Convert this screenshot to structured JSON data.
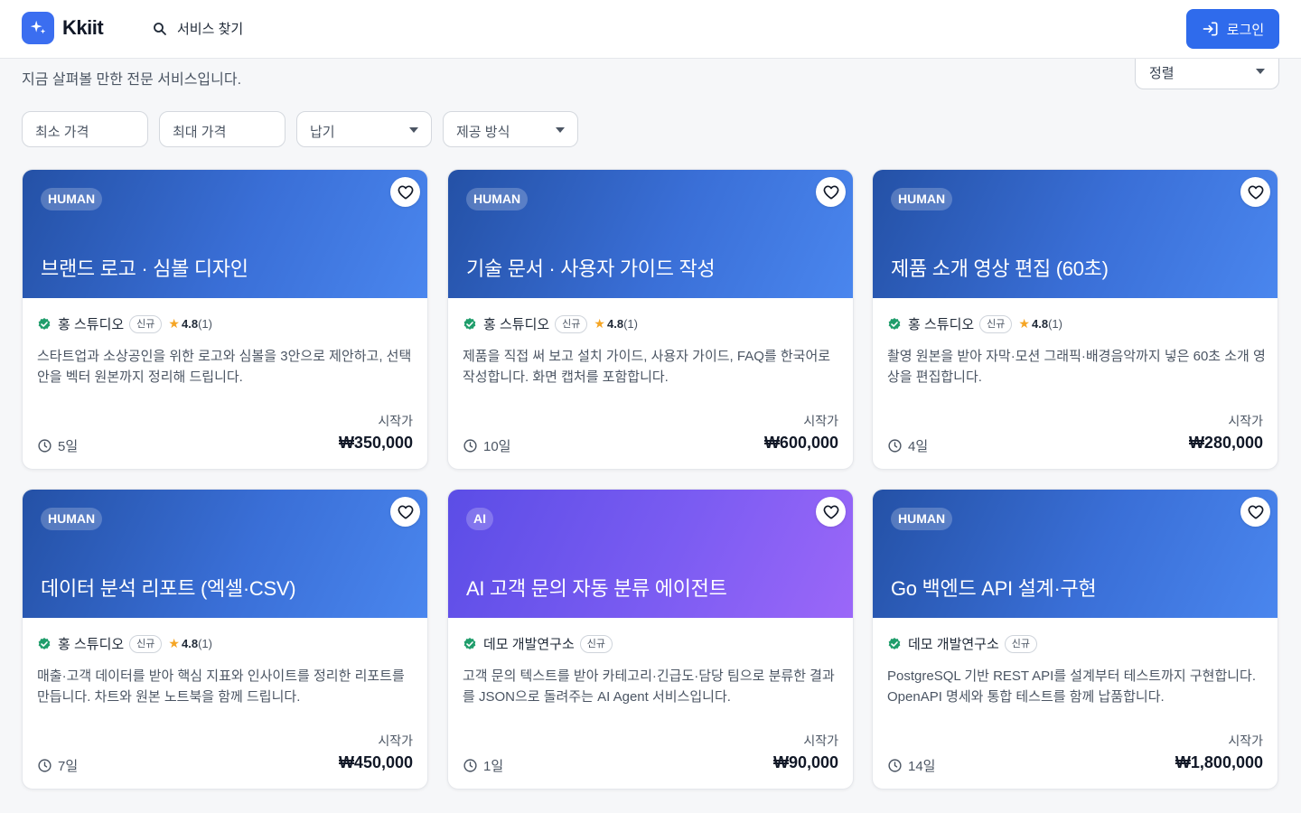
{
  "header": {
    "brand": "Kkiit",
    "search_label": "서비스 찾기",
    "login_label": "로그인"
  },
  "subtitle": "지금 살펴볼 만한 전문 서비스입니다.",
  "sort": {
    "label": "정렬"
  },
  "filters": {
    "min_price": "최소 가격",
    "max_price": "최대 가격",
    "delivery": "납기",
    "provider": "제공 방식"
  },
  "colors": {
    "accent": "#2f6bec",
    "human_banner": "#3a6fd7",
    "ai_banner": "#7b5cf2",
    "star": "#f5a524",
    "verified": "#1f9d6b"
  },
  "cards": [
    {
      "type": "HUMAN",
      "title": "브랜드 로고 · 심볼 디자인",
      "seller": "홍 스튜디오",
      "tag": "신규",
      "rating": "4.8",
      "rating_count": "(1)",
      "description": "스타트업과 소상공인을 위한 로고와 심볼을 3안으로 제안하고, 선택안을 벡터 원본까지 정리해 드립니다.",
      "price_label": "시작가",
      "duration": "5일",
      "price": "₩350,000"
    },
    {
      "type": "HUMAN",
      "title": "기술 문서 · 사용자 가이드 작성",
      "seller": "홍 스튜디오",
      "tag": "신규",
      "rating": "4.8",
      "rating_count": "(1)",
      "description": "제품을 직접 써 보고 설치 가이드, 사용자 가이드, FAQ를 한국어로 작성합니다. 화면 캡처를 포함합니다.",
      "price_label": "시작가",
      "duration": "10일",
      "price": "₩600,000"
    },
    {
      "type": "HUMAN",
      "title": "제품 소개 영상 편집 (60초)",
      "seller": "홍 스튜디오",
      "tag": "신규",
      "rating": "4.8",
      "rating_count": "(1)",
      "description": "촬영 원본을 받아 자막·모션 그래픽·배경음악까지 넣은 60초 소개 영상을 편집합니다.",
      "price_label": "시작가",
      "duration": "4일",
      "price": "₩280,000"
    },
    {
      "type": "HUMAN",
      "title": "데이터 분석 리포트 (엑셀·CSV)",
      "seller": "홍 스튜디오",
      "tag": "신규",
      "rating": "4.8",
      "rating_count": "(1)",
      "description": "매출·고객 데이터를 받아 핵심 지표와 인사이트를 정리한 리포트를 만듭니다. 차트와 원본 노트북을 함께 드립니다.",
      "price_label": "시작가",
      "duration": "7일",
      "price": "₩450,000"
    },
    {
      "type": "AI",
      "title": "AI 고객 문의 자동 분류 에이전트",
      "seller": "데모 개발연구소",
      "tag": "신규",
      "description": "고객 문의 텍스트를 받아 카테고리·긴급도·담당 팀으로 분류한 결과를 JSON으로 돌려주는 AI Agent 서비스입니다.",
      "price_label": "시작가",
      "duration": "1일",
      "price": "₩90,000"
    },
    {
      "type": "HUMAN",
      "title": "Go 백엔드 API 설계·구현",
      "seller": "데모 개발연구소",
      "tag": "신규",
      "description": "PostgreSQL 기반 REST API를 설계부터 테스트까지 구현합니다. OpenAPI 명세와 통합 테스트를 함께 납품합니다.",
      "price_label": "시작가",
      "duration": "14일",
      "price": "₩1,800,000"
    }
  ]
}
